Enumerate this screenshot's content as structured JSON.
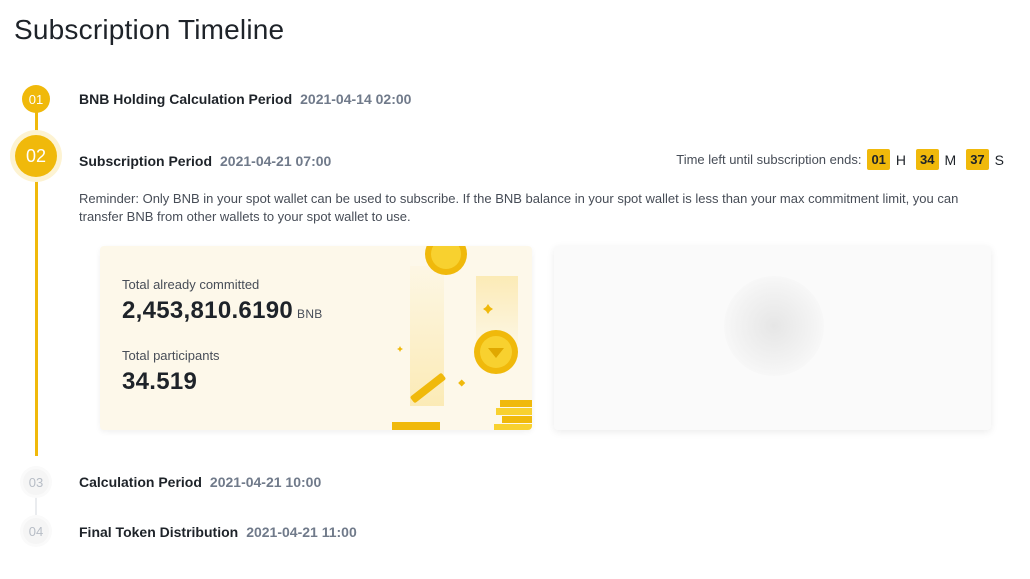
{
  "page": {
    "title": "Subscription Timeline"
  },
  "steps": [
    {
      "number": "01",
      "name": "BNB Holding Calculation Period",
      "date": "2021-04-14 02:00"
    },
    {
      "number": "02",
      "name": "Subscription Period",
      "date": "2021-04-21 07:00"
    },
    {
      "number": "03",
      "name": "Calculation Period",
      "date": "2021-04-21 10:00"
    },
    {
      "number": "04",
      "name": "Final Token Distribution",
      "date": "2021-04-21 11:00"
    }
  ],
  "timer": {
    "label": "Time left until subscription ends:",
    "hours": "01",
    "hours_unit": "H",
    "minutes": "34",
    "minutes_unit": "M",
    "seconds": "37",
    "seconds_unit": "S"
  },
  "reminder": "Reminder: Only BNB in your spot wallet can be used to subscribe. If the BNB balance in your spot wallet is less than your max commitment limit, you can transfer BNB from other wallets to your spot wallet to use.",
  "stats": {
    "committed_label": "Total already committed",
    "committed_value": "2,453,810.6190",
    "committed_unit": "BNB",
    "participants_label": "Total participants",
    "participants_value": "34.519"
  },
  "colors": {
    "accent": "#f0b90b",
    "text": "#1e2329",
    "muted": "#707a8a",
    "card_bg": "#fdf8ea"
  },
  "icons": [
    "coin-icon",
    "sparkle-icon",
    "coin-stack-icon"
  ]
}
